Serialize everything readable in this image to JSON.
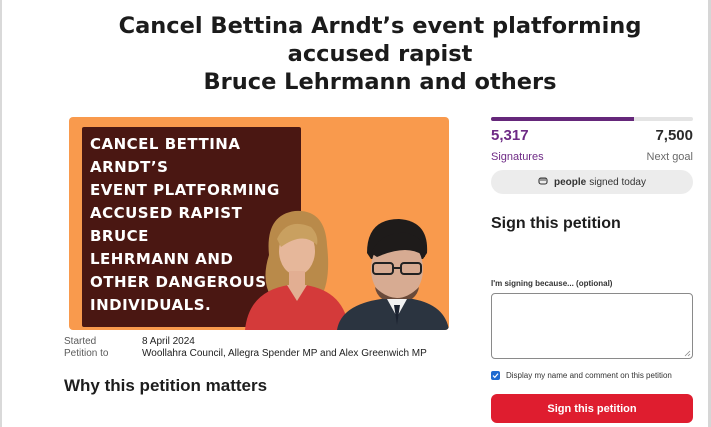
{
  "petition": {
    "title_line1": "Cancel Bettina Arndt’s event platforming accused rapist",
    "title_line2": "Bruce Lehrmann and others",
    "image_text": {
      "line1": "CANCEL BETTINA ARNDT’S",
      "line2": "EVENT PLATFORMING",
      "line3": "ACCUSED RAPIST BRUCE",
      "line4": "LEHRMANN AND",
      "line5": "OTHER DANGEROUS",
      "line6": "INDIVIDUALS."
    },
    "started_label": "Started",
    "started_date": "8 April 2024",
    "petition_to_label": "Petition to",
    "petition_to": "Woollahra Council, Allegra Spender MP and Alex Greenwich MP",
    "why_heading": "Why this petition matters"
  },
  "signatures": {
    "count": "5,317",
    "count_label": "Signatures",
    "goal": "7,500",
    "goal_label": "Next goal",
    "progress_fraction": 0.709,
    "today_bold": "people",
    "today_text": "signed today"
  },
  "sign_form": {
    "title": "Sign this petition",
    "reason_label": "I'm signing because... (optional)",
    "reason_value": "",
    "display_label": "Display my name and comment on this petition",
    "display_checked": true,
    "button_label": "Sign this petition"
  },
  "colors": {
    "brand_purple": "#6e2a85",
    "sign_red": "#df1d2f",
    "hero_orange": "#f99a4d",
    "hero_text_bg": "#4a1712",
    "checkbox_blue": "#1f6ad0"
  },
  "icons": {
    "today": "fist-icon",
    "checkbox": "check-icon"
  }
}
